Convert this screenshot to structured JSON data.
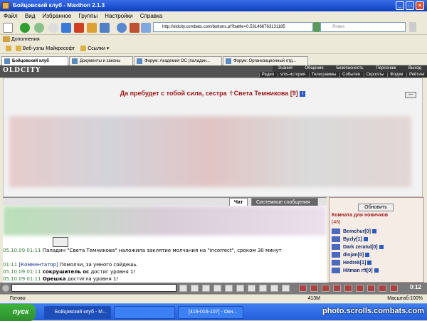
{
  "window": {
    "title": "Бойцовский клуб - Maxthon 2.1.3"
  },
  "menu": [
    "Файл",
    "Вид",
    "Избранное",
    "Группы",
    "Настройки",
    "Справка"
  ],
  "address": {
    "value": "http://oldcity.combats.com/buttons.pl?battle=0.531466763131185"
  },
  "search": {
    "placeholder": "Яndex"
  },
  "toolbar2": {
    "label": "Дополнения"
  },
  "links": {
    "item1": "Веб-узлы Майкрософт",
    "item2": "Ссылки"
  },
  "tabs": [
    {
      "label": "Бойцовский клуб"
    },
    {
      "label": "Документы и законы"
    },
    {
      "label": "Форум: Академия ОС (паладин..."
    },
    {
      "label": "Форум: Организационный отд..."
    }
  ],
  "game": {
    "logo": "OLDCITY",
    "nav1": [
      "Знания",
      "Общение",
      "Безопасность",
      "Персонаж",
      "Выход"
    ],
    "nav2": [
      "Радио",
      "sms-история",
      "Телеграммы",
      "События",
      "Скроллы",
      "Форум",
      "Рейтинг"
    ],
    "greeting_prefix": "Да пребудет с тобой сила, сестра",
    "greeting_name": "Света Темникова",
    "greeting_level": "[9]",
    "mini_btn": "—"
  },
  "chat": {
    "tabs": [
      "Чат",
      "Системные сообщения"
    ],
    "messages": [
      {
        "time": "05.10.09 01:11",
        "text": "Паладин \"Света Темникова\" наложила заклятие молчания на \"incorrect\", сроком 30 минут"
      },
      {
        "time": "01:11",
        "who": "[Комментатор]",
        "text": "Помолчи, за умного сойдешь."
      },
      {
        "time": "05.10.09 01:11",
        "who": "сокрушитель ос",
        "text": "достиг уровня 1!"
      },
      {
        "time": "05.10.09 01:11",
        "who": "Орешка",
        "text": "достигла уровня 1!"
      }
    ]
  },
  "room": {
    "refresh": "Обновить",
    "title": "Комната для новичков",
    "count": "(46)",
    "users": [
      "Bemchur[0]",
      "Byzly[1]",
      "Dark zeratul[0]",
      "diojan[0]",
      "Hedrek[1]",
      "Hitman rft[0]"
    ]
  },
  "clock": "0:12",
  "status": {
    "left": "Готово",
    "memory": "413M",
    "zoom": "Масштаб:100%"
  },
  "taskbar": {
    "start": "пуск",
    "items": [
      "Бойцовский клуб - M...",
      "[419-016-107] - Окн..."
    ]
  },
  "watermark": "photo.scrolls.combats.com"
}
